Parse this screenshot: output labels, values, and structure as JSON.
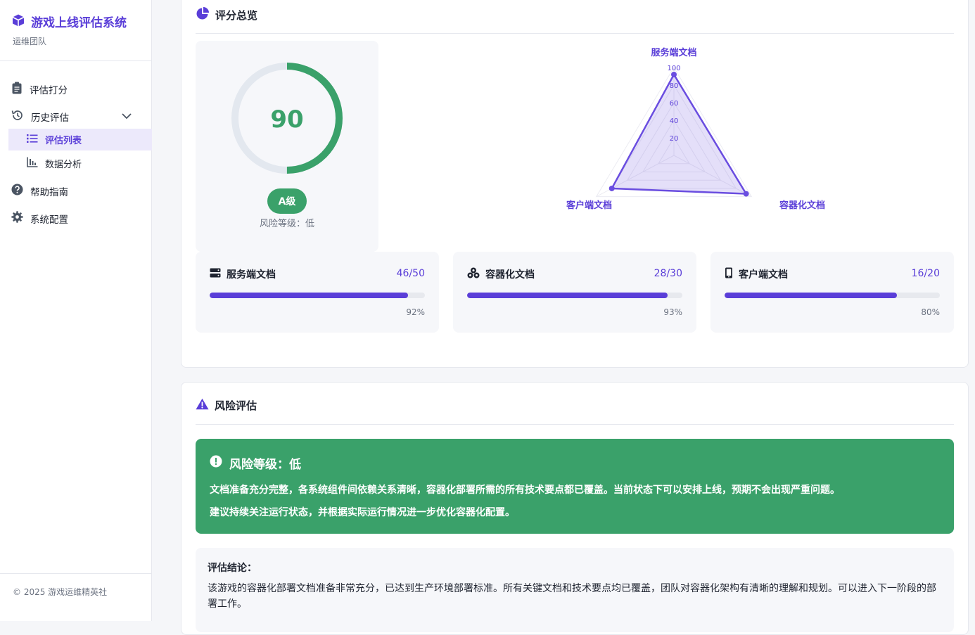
{
  "brand": {
    "title": "游戏上线评估系统",
    "subtitle": "运维团队"
  },
  "nav": {
    "score": "评估打分",
    "history": "历史评估",
    "list": "评估列表",
    "analysis": "数据分析",
    "help": "帮助指南",
    "config": "系统配置"
  },
  "footer": "© 2025 游戏运维精英社",
  "overview": {
    "title": "评分总览",
    "score": "90",
    "score_fraction": 0.9,
    "grade": "A级",
    "risk_level": "风险等级：低"
  },
  "chart_data": {
    "type": "radar",
    "axes": [
      "服务端文档",
      "容器化文档",
      "客户端文档"
    ],
    "values": [
      92,
      93,
      80
    ],
    "ticks": [
      "20",
      "40",
      "60",
      "80",
      "100"
    ],
    "range": [
      0,
      100
    ],
    "color": "#6a4de0"
  },
  "metrics": [
    {
      "name": "服务端文档",
      "value": "46/50",
      "percent": "92%",
      "fraction": 0.92,
      "icon": "server-icon"
    },
    {
      "name": "容器化文档",
      "value": "28/30",
      "percent": "93%",
      "fraction": 0.93,
      "icon": "cubes-icon"
    },
    {
      "name": "客户端文档",
      "value": "16/20",
      "percent": "80%",
      "fraction": 0.8,
      "icon": "mobile-icon"
    }
  ],
  "risk": {
    "title": "风险评估",
    "banner_title": "风险等级：低",
    "line1": "文档准备充分完整，各系统组件间依赖关系清晰，容器化部署所需的所有技术要点都已覆盖。当前状态下可以安排上线，预期不会出现严重问题。",
    "line2": "建议持续关注运行状态，并根据实际运行情况进一步优化容器化配置。"
  },
  "conclusion": {
    "title": "评估结论：",
    "text": "该游戏的容器化部署文档准备非常充分，已达到生产环境部署标准。所有关键文档和技术要点均已覆盖，团队对容器化架构有清晰的理解和规划。可以进入下一阶段的部署工作。"
  },
  "colors": {
    "accent": "#5a3ed8",
    "success": "#3aa16a",
    "muted": "#6b7280"
  }
}
